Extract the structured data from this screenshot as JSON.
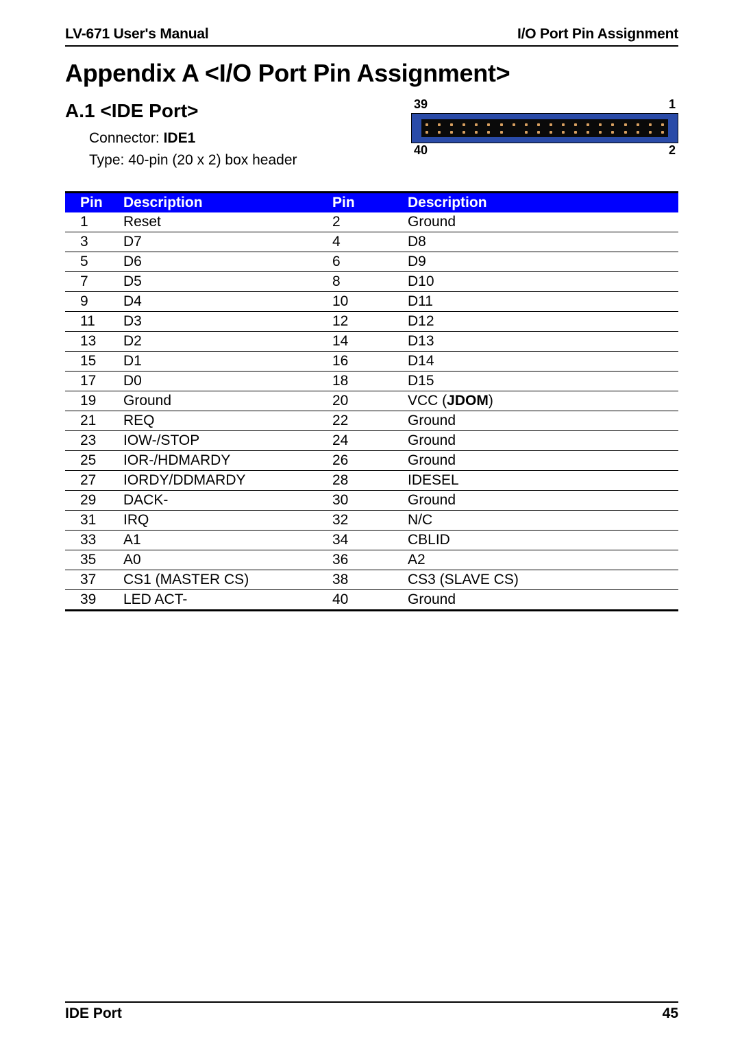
{
  "header": {
    "left": "LV-671 User's Manual",
    "right": "I/O Port Pin Assignment"
  },
  "title": "Appendix A <I/O Port Pin Assignment>",
  "section": {
    "heading": "A.1 <IDE Port>",
    "line1_prefix": "Connector: ",
    "line1_bold": "IDE1",
    "line2": "Type: 40-pin (20 x 2) box header"
  },
  "connector_labels": {
    "top_left": "39",
    "top_right": "1",
    "bottom_left": "40",
    "bottom_right": "2"
  },
  "table": {
    "headers": [
      "Pin",
      "Description",
      "Pin",
      "Description"
    ],
    "rows": [
      {
        "p1": "1",
        "d1": "Reset",
        "p2": "2",
        "d2": "Ground"
      },
      {
        "p1": "3",
        "d1": "D7",
        "p2": "4",
        "d2": "D8"
      },
      {
        "p1": "5",
        "d1": "D6",
        "p2": "6",
        "d2": "D9"
      },
      {
        "p1": "7",
        "d1": "D5",
        "p2": "8",
        "d2": "D10"
      },
      {
        "p1": "9",
        "d1": "D4",
        "p2": "10",
        "d2": "D11"
      },
      {
        "p1": "11",
        "d1": "D3",
        "p2": "12",
        "d2": "D12"
      },
      {
        "p1": "13",
        "d1": "D2",
        "p2": "14",
        "d2": "D13"
      },
      {
        "p1": "15",
        "d1": "D1",
        "p2": "16",
        "d2": "D14"
      },
      {
        "p1": "17",
        "d1": "D0",
        "p2": "18",
        "d2": "D15"
      },
      {
        "p1": "19",
        "d1": "Ground",
        "p2": "20",
        "d2_prefix": "VCC (",
        "d2_bold": "JDOM",
        "d2_suffix": ")"
      },
      {
        "p1": "21",
        "d1": "REQ",
        "p2": "22",
        "d2": "Ground"
      },
      {
        "p1": "23",
        "d1": "IOW-/STOP",
        "p2": "24",
        "d2": "Ground"
      },
      {
        "p1": "25",
        "d1": "IOR-/HDMARDY",
        "p2": "26",
        "d2": "Ground"
      },
      {
        "p1": "27",
        "d1": "IORDY/DDMARDY",
        "p2": "28",
        "d2": "IDESEL"
      },
      {
        "p1": "29",
        "d1": "DACK-",
        "p2": "30",
        "d2": "Ground"
      },
      {
        "p1": "31",
        "d1": "IRQ",
        "p2": "32",
        "d2": "N/C"
      },
      {
        "p1": "33",
        "d1": "A1",
        "p2": "34",
        "d2": "CBLID"
      },
      {
        "p1": "35",
        "d1": "A0",
        "p2": "36",
        "d2": "A2"
      },
      {
        "p1": "37",
        "d1": "CS1 (MASTER CS)",
        "p2": "38",
        "d2": "CS3 (SLAVE CS)"
      },
      {
        "p1": "39",
        "d1": "LED ACT-",
        "p2": "40",
        "d2": "Ground"
      }
    ]
  },
  "footer": {
    "left": "IDE Port",
    "right": "45"
  }
}
